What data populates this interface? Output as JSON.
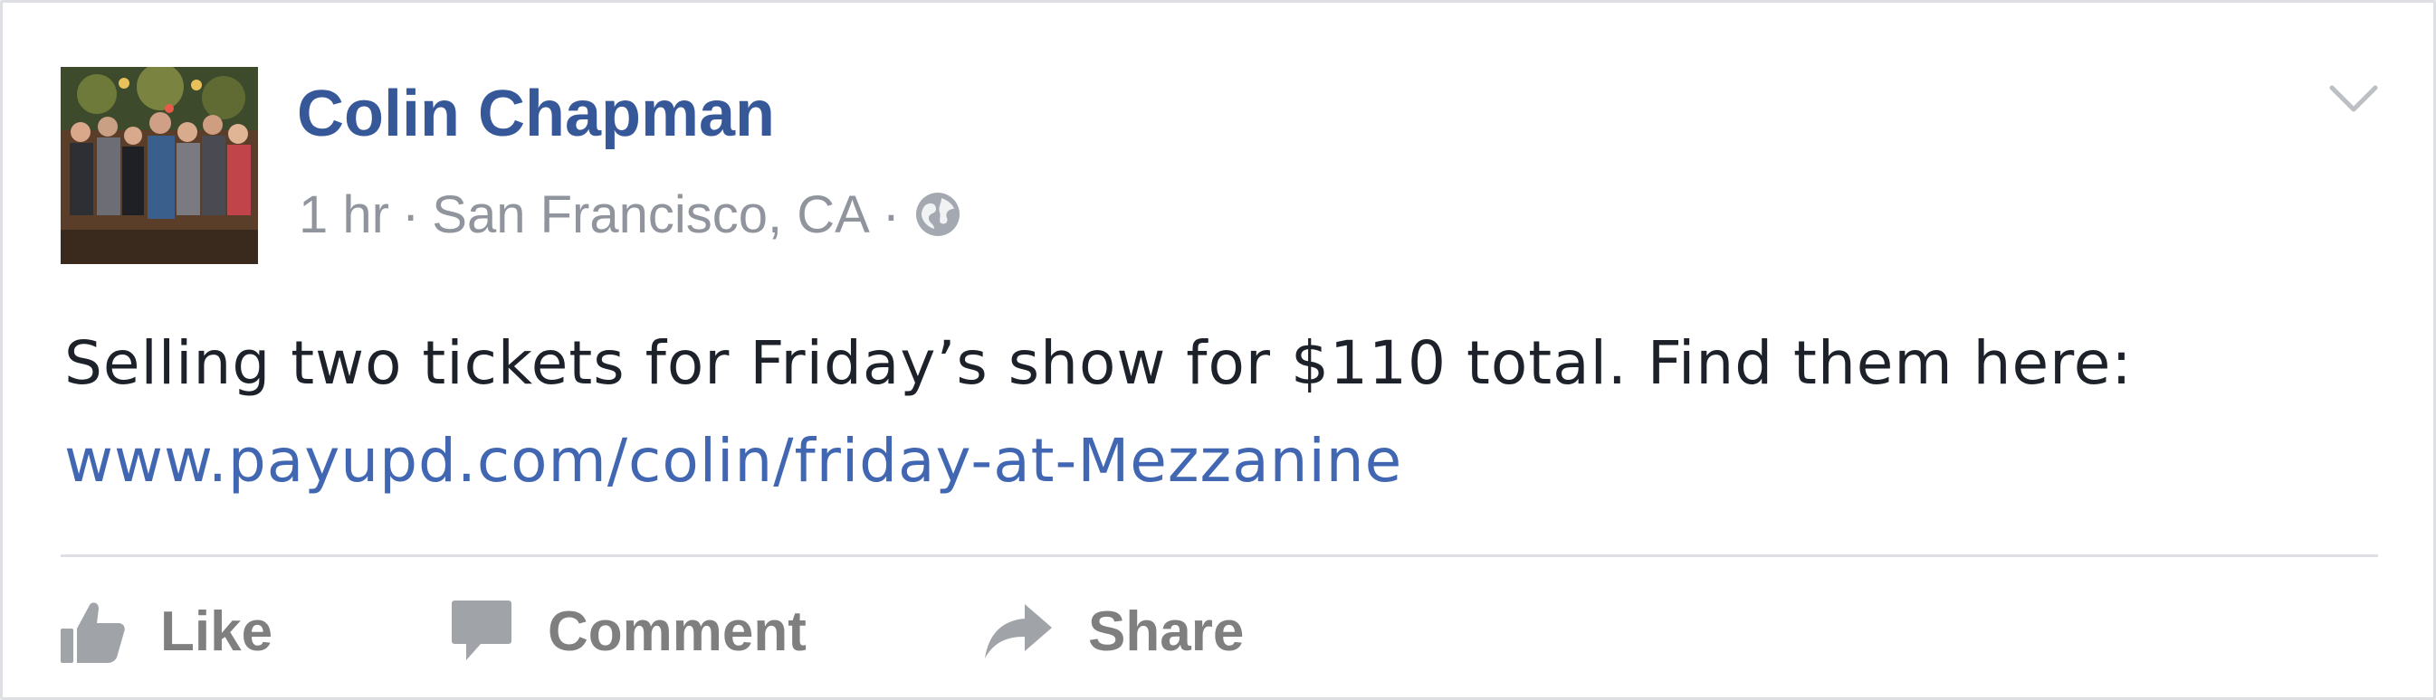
{
  "post": {
    "author_name": "Colin Chapman",
    "timestamp": "1 hr",
    "separator": "·",
    "location": "San Francisco, CA",
    "privacy_icon": "globe-icon",
    "options_icon": "chevron-down-icon",
    "text_before_link": "Selling two tickets for Friday’s show for $110 total. Find them here: ",
    "link_text": "www.payupd.com/colin/friday-at-Mezzanine"
  },
  "actions": {
    "like_label": "Like",
    "comment_label": "Comment",
    "share_label": "Share"
  },
  "colors": {
    "author_name": "#365899",
    "link": "#4267b2",
    "meta_text": "#90949c",
    "action_text": "#7f7f7f",
    "body_text": "#1d2129"
  }
}
